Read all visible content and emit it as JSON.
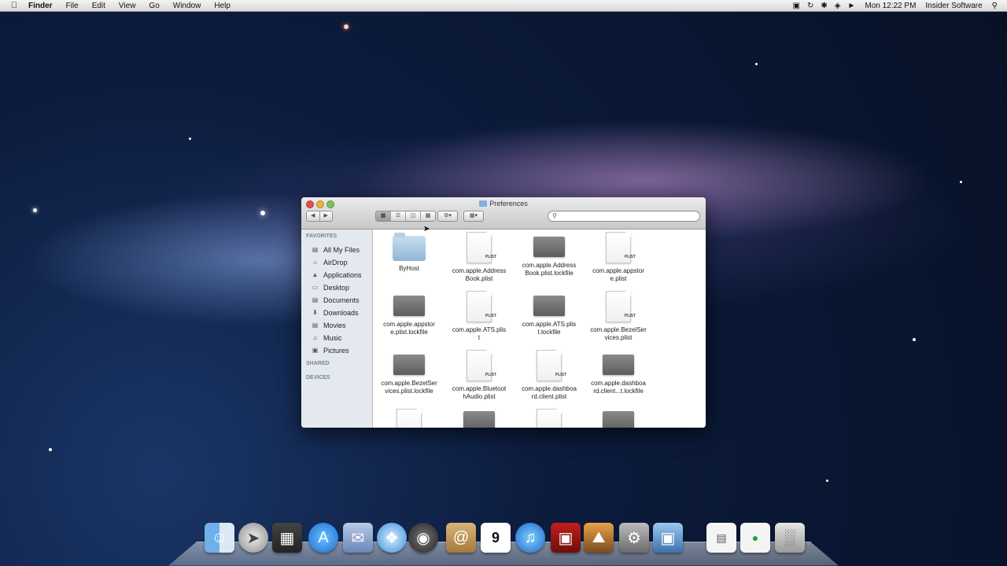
{
  "menubar": {
    "apple": "",
    "items": [
      "Finder",
      "File",
      "Edit",
      "View",
      "Go",
      "Window",
      "Help"
    ],
    "clock": "Mon 12:22 PM",
    "user": "Insider Software"
  },
  "window": {
    "title": "Preferences",
    "nav": {
      "back": "◀",
      "forward": "▶"
    },
    "view_modes": [
      "icon-view",
      "list-view",
      "column-view",
      "coverflow-view"
    ],
    "selected_view": "icon-view",
    "search": {
      "value": "",
      "placeholder": ""
    },
    "sidebar": {
      "favorites_header": "FAVORITES",
      "favorites": [
        {
          "label": "All My Files",
          "icon": "all-files-icon"
        },
        {
          "label": "AirDrop",
          "icon": "airdrop-icon"
        },
        {
          "label": "Applications",
          "icon": "applications-icon"
        },
        {
          "label": "Desktop",
          "icon": "desktop-icon"
        },
        {
          "label": "Documents",
          "icon": "documents-icon"
        },
        {
          "label": "Downloads",
          "icon": "downloads-icon"
        },
        {
          "label": "Movies",
          "icon": "movies-icon"
        },
        {
          "label": "Music",
          "icon": "music-icon"
        },
        {
          "label": "Pictures",
          "icon": "pictures-icon"
        }
      ],
      "shared_header": "SHARED",
      "devices_header": "DEVICES"
    },
    "files": [
      {
        "line1": "ByHost",
        "line2": "",
        "kind": "folder"
      },
      {
        "line1": "com.apple.Address",
        "line2": "Book.plist",
        "kind": "plist"
      },
      {
        "line1": "com.apple.Address",
        "line2": "Book.plist.lockfile",
        "kind": "lockfile"
      },
      {
        "line1": "com.apple.appstor",
        "line2": "e.plist",
        "kind": "plist"
      },
      {
        "line1": "com.apple.appstor",
        "line2": "e.plist.lockfile",
        "kind": "lockfile"
      },
      {
        "line1": "com.apple.ATS.plis",
        "line2": "t",
        "kind": "plist"
      },
      {
        "line1": "com.apple.ATS.plis",
        "line2": "t.lockfile",
        "kind": "lockfile"
      },
      {
        "line1": "com.apple.BezelSer",
        "line2": "vices.plist",
        "kind": "plist"
      },
      {
        "line1": "com.apple.BezelSer",
        "line2": "vices.plist.lockfile",
        "kind": "lockfile"
      },
      {
        "line1": "com.apple.Bluetoot",
        "line2": "hAudio.plist",
        "kind": "plist"
      },
      {
        "line1": "com.apple.dashboa",
        "line2": "rd.client.plist",
        "kind": "plist"
      },
      {
        "line1": "com.apple.dashboa",
        "line2": "rd.client...t.lockfile",
        "kind": "lockfile"
      }
    ],
    "plist_label": "PLIST"
  },
  "dock": {
    "items": [
      "finder-icon",
      "launchpad-icon",
      "mission-control-icon",
      "app-store-icon",
      "mail-icon",
      "safari-icon",
      "facetime-icon",
      "address-book-icon",
      "ical-icon",
      "itunes-icon",
      "photo-booth-icon",
      "iphoto-icon",
      "system-preferences-icon",
      "preview-icon",
      "document-icon",
      "document-icon",
      "trash-icon"
    ],
    "ical_date": "9"
  }
}
